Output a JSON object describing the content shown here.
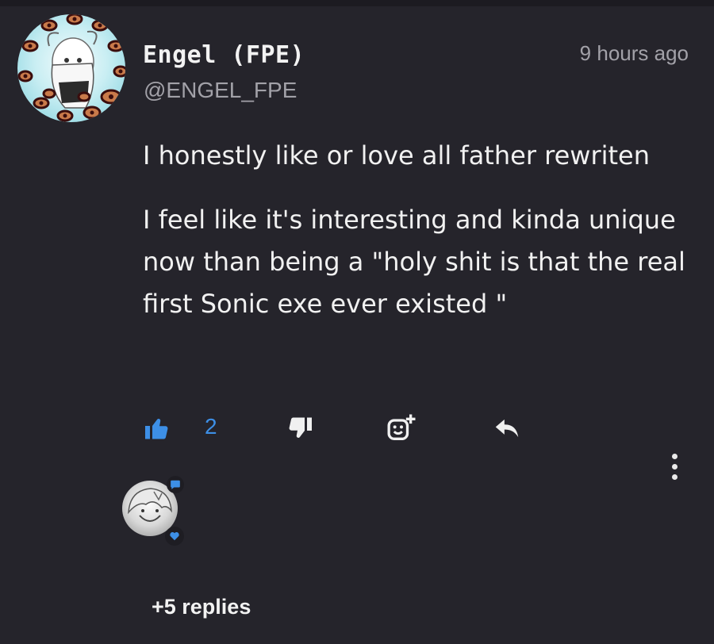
{
  "comment": {
    "author": {
      "name": "Engel (FPE)",
      "handle": "@ENGEL_FPE"
    },
    "timestamp": "9 hours ago",
    "paragraphs": [
      "I honestly like or love all father rewriten",
      "I feel like it's interesting and kinda unique now than being a \"holy shit is that the real first Sonic exe ever existed \""
    ],
    "actions": {
      "likes": "2",
      "like_icon": "thumbs-up-icon",
      "dislike_icon": "thumbs-down-icon",
      "react_icon": "add-reaction-icon",
      "reply_icon": "reply-arrow-icon",
      "more_icon": "vertical-ellipsis-icon"
    },
    "reply_preview": {
      "badges": [
        "chat-bubble-icon",
        "heart-icon"
      ],
      "replies_label": "+5 replies"
    }
  },
  "colors": {
    "background": "#25242b",
    "accent": "#3d8fe6",
    "text": "#f1f1f1",
    "muted": "#a2a1a8"
  }
}
